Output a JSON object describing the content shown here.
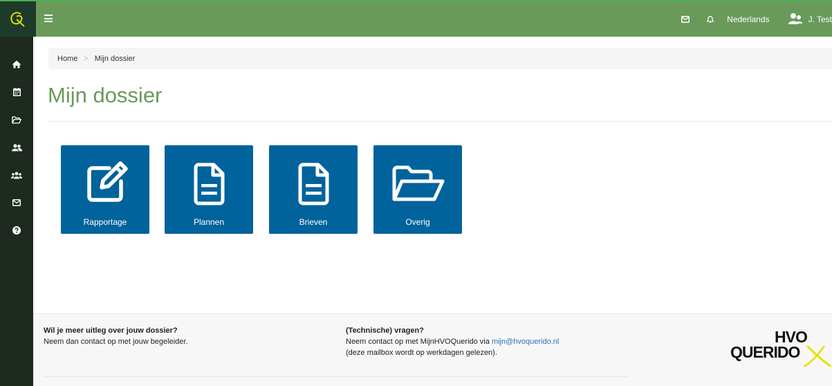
{
  "header": {
    "language": "Nederlands",
    "user": "J. Test"
  },
  "sidebar": {
    "items": [
      "home",
      "calendar",
      "folder",
      "users",
      "group",
      "mail",
      "help"
    ]
  },
  "breadcrumb": {
    "home": "Home",
    "separator": ">",
    "current": "Mijn dossier"
  },
  "page": {
    "title": "Mijn dossier"
  },
  "tiles": [
    {
      "label": "Rapportage",
      "icon": "edit-icon"
    },
    {
      "label": "Plannen",
      "icon": "document-icon"
    },
    {
      "label": "Brieven",
      "icon": "document-icon"
    },
    {
      "label": "Overig",
      "icon": "folder-open-icon"
    }
  ],
  "footer": {
    "left_title": "Wil je meer uitleg over jouw dossier?",
    "left_text": "Neem dan contact op met jouw begeleider.",
    "right_title": "(Technische) vragen?",
    "right_text": "Neem contact op met MijnHVOQuerido via",
    "email": "mijn@hvoquerido.nl",
    "right_note": "(deze mailbox wordt op werkdagen gelezen).",
    "logo_line1": "HVO",
    "logo_line2": "QUERIDO"
  },
  "colors": {
    "topbar": "#6a9a5a",
    "sidebar": "#1e2a1f",
    "tile": "#00639b",
    "title": "#6a9a5a",
    "link": "#2b73b8",
    "logo_accent": "#e8e000"
  }
}
